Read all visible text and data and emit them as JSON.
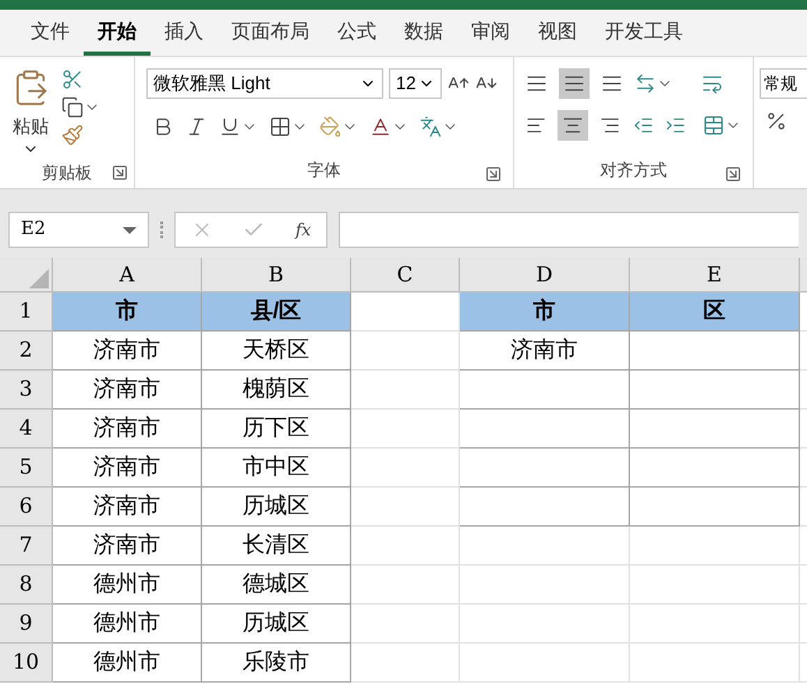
{
  "ribbon_tabs": [
    {
      "label": "文件",
      "selected": false
    },
    {
      "label": "开始",
      "selected": true
    },
    {
      "label": "插入",
      "selected": false
    },
    {
      "label": "页面布局",
      "selected": false
    },
    {
      "label": "公式",
      "selected": false
    },
    {
      "label": "数据",
      "selected": false
    },
    {
      "label": "审阅",
      "selected": false
    },
    {
      "label": "视图",
      "selected": false
    },
    {
      "label": "开发工具",
      "selected": false
    }
  ],
  "ribbon": {
    "clipboard": {
      "paste_label": "粘贴",
      "group_label": "剪贴板"
    },
    "font": {
      "font_name": "微软雅黑 Light",
      "font_size": "12",
      "group_label": "字体"
    },
    "alignment": {
      "group_label": "对齐方式"
    },
    "number": {
      "format": "常规"
    }
  },
  "formula_bar": {
    "name_box": "E2",
    "function_label": "fx"
  },
  "sheet": {
    "columns": [
      "A",
      "B",
      "C",
      "D",
      "E"
    ],
    "rows": [
      {
        "number": "1",
        "cells": [
          {
            "text": "市",
            "bordered": true,
            "header": true
          },
          {
            "text": "县/区",
            "bordered": true,
            "header": true
          },
          {
            "bordered": false,
            "header": false
          },
          {
            "text": "市",
            "bordered": true,
            "header": true
          },
          {
            "text": "区",
            "bordered": true,
            "header": true
          }
        ]
      },
      {
        "number": "2",
        "cells": [
          {
            "text": "济南市",
            "bordered": true,
            "header": false
          },
          {
            "text": "天桥区",
            "bordered": true,
            "header": false
          },
          {
            "bordered": false,
            "header": false
          },
          {
            "text": "济南市",
            "bordered": true,
            "header": false
          },
          {
            "bordered": true,
            "header": false
          }
        ]
      },
      {
        "number": "3",
        "cells": [
          {
            "text": "济南市",
            "bordered": true,
            "header": false
          },
          {
            "text": "槐荫区",
            "bordered": true,
            "header": false
          },
          {
            "bordered": false,
            "header": false
          },
          {
            "bordered": true,
            "header": false
          },
          {
            "bordered": true,
            "header": false
          }
        ]
      },
      {
        "number": "4",
        "cells": [
          {
            "text": "济南市",
            "bordered": true,
            "header": false
          },
          {
            "text": "历下区",
            "bordered": true,
            "header": false
          },
          {
            "bordered": false,
            "header": false
          },
          {
            "bordered": true,
            "header": false
          },
          {
            "bordered": true,
            "header": false
          }
        ]
      },
      {
        "number": "5",
        "cells": [
          {
            "text": "济南市",
            "bordered": true,
            "header": false
          },
          {
            "text": "市中区",
            "bordered": true,
            "header": false
          },
          {
            "bordered": false,
            "header": false
          },
          {
            "bordered": true,
            "header": false
          },
          {
            "bordered": true,
            "header": false
          }
        ]
      },
      {
        "number": "6",
        "cells": [
          {
            "text": "济南市",
            "bordered": true,
            "header": false
          },
          {
            "text": "历城区",
            "bordered": true,
            "header": false
          },
          {
            "bordered": false,
            "header": false
          },
          {
            "bordered": true,
            "header": false
          },
          {
            "bordered": true,
            "header": false
          }
        ]
      },
      {
        "number": "7",
        "cells": [
          {
            "text": "济南市",
            "bordered": true,
            "header": false
          },
          {
            "text": "长清区",
            "bordered": true,
            "header": false
          },
          {
            "bordered": false,
            "header": false
          },
          {
            "bordered": false,
            "header": false
          },
          {
            "bordered": false,
            "header": false
          }
        ]
      },
      {
        "number": "8",
        "cells": [
          {
            "text": "德州市",
            "bordered": true,
            "header": false
          },
          {
            "text": "德城区",
            "bordered": true,
            "header": false
          },
          {
            "bordered": false,
            "header": false
          },
          {
            "bordered": false,
            "header": false
          },
          {
            "bordered": false,
            "header": false
          }
        ]
      },
      {
        "number": "9",
        "cells": [
          {
            "text": "德州市",
            "bordered": true,
            "header": false
          },
          {
            "text": "历城区",
            "bordered": true,
            "header": false
          },
          {
            "bordered": false,
            "header": false
          },
          {
            "bordered": false,
            "header": false
          },
          {
            "bordered": false,
            "header": false
          }
        ]
      },
      {
        "number": "10",
        "cells": [
          {
            "text": "德州市",
            "bordered": true,
            "header": false
          },
          {
            "text": "乐陵市",
            "bordered": true,
            "header": false
          },
          {
            "bordered": false,
            "header": false
          },
          {
            "bordered": false,
            "header": false
          },
          {
            "bordered": false,
            "header": false
          }
        ]
      }
    ]
  }
}
